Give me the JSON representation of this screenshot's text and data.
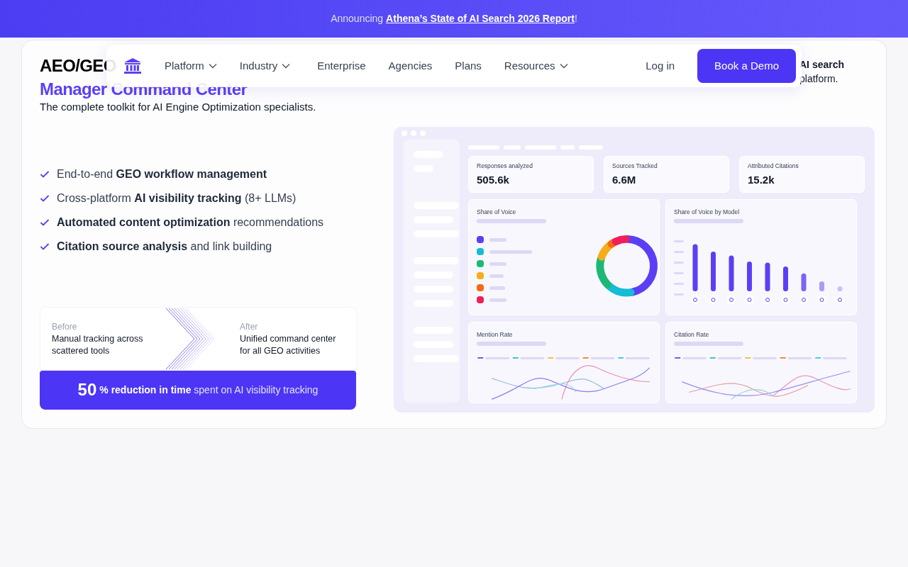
{
  "announcement": {
    "prefix": "Announcing",
    "link": "Athena’s State of AI Search 2026 Report",
    "suffix": "!"
  },
  "nav": {
    "items": [
      {
        "label": "Platform",
        "dropdown": true
      },
      {
        "label": "Industry",
        "dropdown": true
      },
      {
        "label": "Enterprise",
        "dropdown": false
      },
      {
        "label": "Agencies",
        "dropdown": false
      },
      {
        "label": "Plans",
        "dropdown": false
      },
      {
        "label": "Resources",
        "dropdown": true
      }
    ],
    "login": "Log in",
    "cta": "Book a Demo"
  },
  "hero": {
    "title_lines": [
      "AEO/GEO",
      "Manager Command Center"
    ],
    "side_text": [
      "**AI search**",
      "platform."
    ],
    "subtitle": "The complete toolkit for AI Engine Optimization specialists.",
    "features": [
      "End-to-end **GEO workflow management**",
      "Cross-platform **AI visibility tracking** (8+ LLMs)",
      "**Automated content optimization** recommendations",
      "**Citation source analysis** and link building"
    ]
  },
  "comparison": {
    "before_label": "Before",
    "before_text": "Manual tracking across scattered tools",
    "after_label": "After",
    "after_text": "Unified command center for all GEO activities"
  },
  "stat": {
    "number": "50",
    "text": "**% reduction in time** spent on AI visibility tracking"
  },
  "dashboard": {
    "metrics": [
      {
        "label": "Responses analyzed",
        "value": "505.6k"
      },
      {
        "label": "Sources Tracked",
        "value": "6.6M"
      },
      {
        "label": "Attributed Citations",
        "value": "15.2k"
      }
    ],
    "share_of_voice": {
      "title": "Share of Voice",
      "legend": [
        {
          "color": "#5b3ff5"
        },
        {
          "color": "#14bcd4"
        },
        {
          "color": "#1db876"
        },
        {
          "color": "#f5ad1b"
        },
        {
          "color": "#f56a14"
        },
        {
          "color": "#f01e5a"
        }
      ]
    },
    "by_model_title": "Share of Voice by Model",
    "mention_title": "Mention Rate",
    "citation_title": "Citation Rate"
  }
}
